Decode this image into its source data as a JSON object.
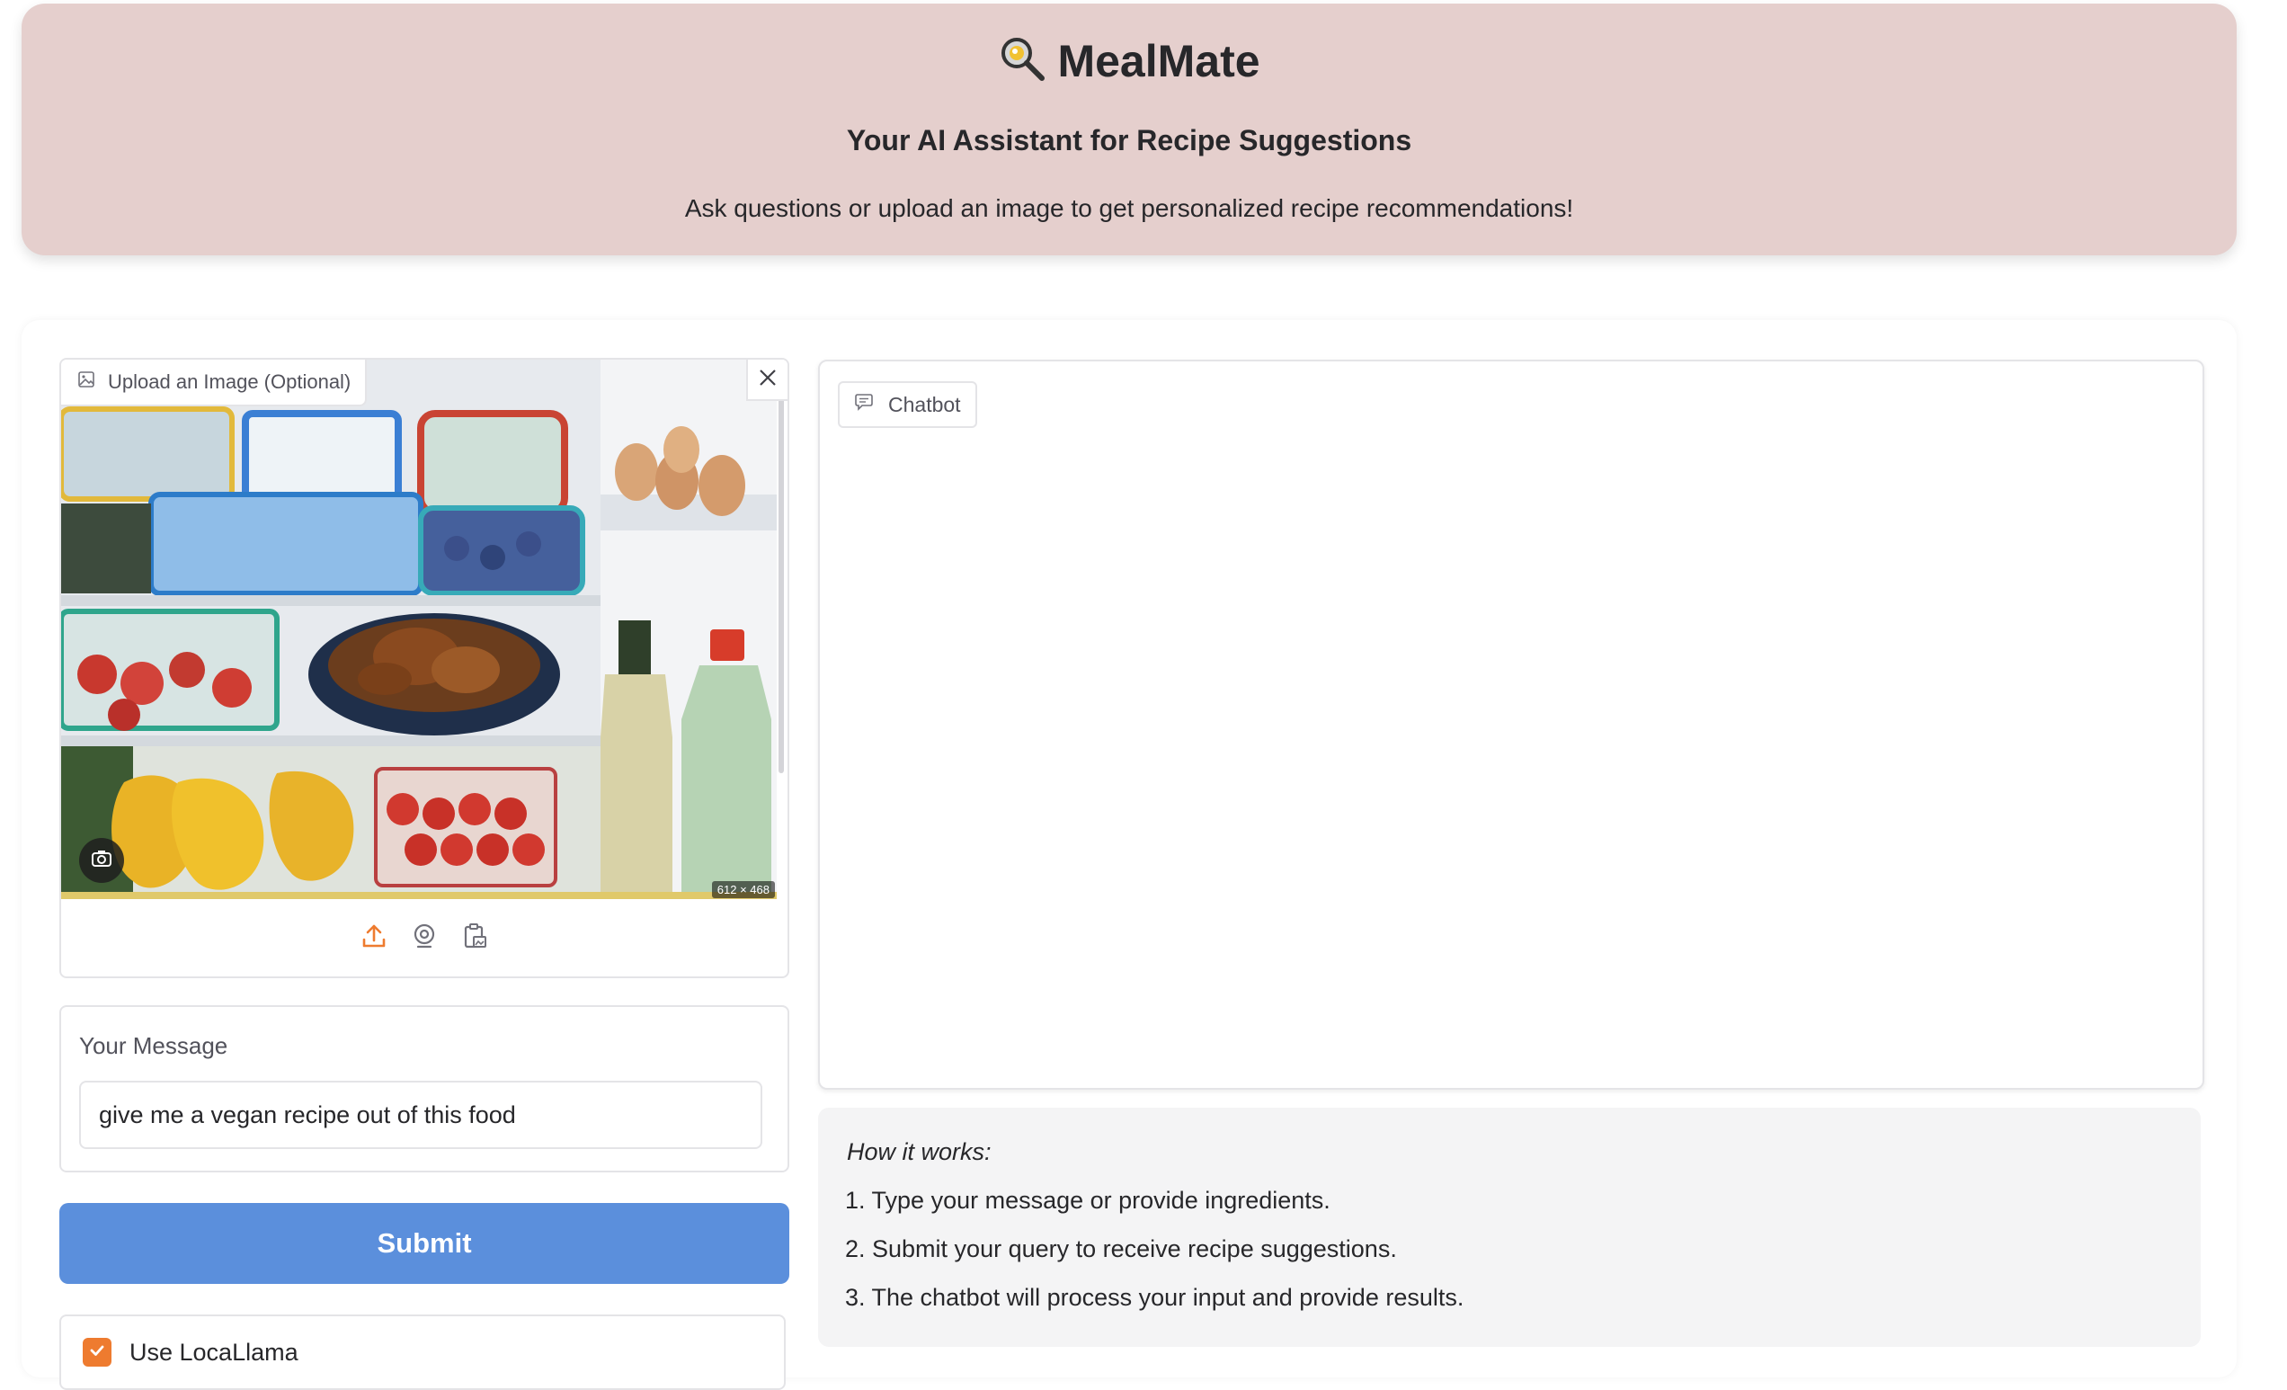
{
  "header": {
    "title": "MealMate",
    "subtitle": "Your AI Assistant for Recipe Suggestions",
    "description": "Ask questions or upload an image to get personalized recipe recommendations!"
  },
  "image_upload": {
    "label": "Upload an Image (Optional)",
    "image_size": "612 × 468"
  },
  "message": {
    "label": "Your Message",
    "value": "give me a vegan recipe out of this food"
  },
  "submit": {
    "label": "Submit"
  },
  "checkbox": {
    "label": "Use LocaLlama",
    "checked": true
  },
  "chatbot": {
    "label": "Chatbot"
  },
  "info": {
    "title": "How it works:",
    "steps": [
      "1. Type your message or provide ingredients.",
      "2. Submit your query to receive recipe suggestions.",
      "3. The chatbot will process your input and provide results."
    ]
  },
  "colors": {
    "header_bg": "#e5cfcd",
    "submit_bg": "#5b8fdc",
    "accent": "#ee7b2f"
  }
}
